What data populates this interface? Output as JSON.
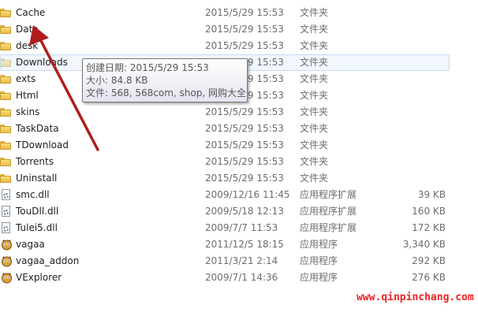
{
  "files": [
    {
      "name": "Cache",
      "date": "2015/5/29 15:53",
      "type": "文件夹",
      "size": "",
      "icon": "folder-icon"
    },
    {
      "name": "Data",
      "date": "2015/5/29 15:53",
      "type": "文件夹",
      "size": "",
      "icon": "folder-icon"
    },
    {
      "name": "desk",
      "date": "2015/5/29 15:53",
      "type": "文件夹",
      "size": "",
      "icon": "folder-icon"
    },
    {
      "name": "Downloads",
      "date": "2015/5/29 15:53",
      "type": "文件夹",
      "size": "",
      "icon": "folder-icon"
    },
    {
      "name": "exts",
      "date": "2015/5/29 15:53",
      "type": "文件夹",
      "size": "",
      "icon": "folder-icon"
    },
    {
      "name": "Html",
      "date": "2015/5/29 15:53",
      "type": "文件夹",
      "size": "",
      "icon": "folder-icon"
    },
    {
      "name": "skins",
      "date": "2015/5/29 15:53",
      "type": "文件夹",
      "size": "",
      "icon": "folder-icon"
    },
    {
      "name": "TaskData",
      "date": "2015/5/29 15:53",
      "type": "文件夹",
      "size": "",
      "icon": "folder-icon"
    },
    {
      "name": "TDownload",
      "date": "2015/5/29 15:53",
      "type": "文件夹",
      "size": "",
      "icon": "folder-icon"
    },
    {
      "name": "Torrents",
      "date": "2015/5/29 15:53",
      "type": "文件夹",
      "size": "",
      "icon": "folder-icon"
    },
    {
      "name": "Uninstall",
      "date": "2015/5/29 15:53",
      "type": "文件夹",
      "size": "",
      "icon": "folder-icon"
    },
    {
      "name": "smc.dll",
      "date": "2009/12/16 11:45",
      "type": "应用程序扩展",
      "size": "39 KB",
      "icon": "dll-file-icon"
    },
    {
      "name": "TouDll.dll",
      "date": "2009/5/18 12:13",
      "type": "应用程序扩展",
      "size": "160 KB",
      "icon": "dll-file-icon"
    },
    {
      "name": "Tulei5.dll",
      "date": "2009/7/7 11:53",
      "type": "应用程序扩展",
      "size": "172 KB",
      "icon": "dll-file-icon"
    },
    {
      "name": "vagaa",
      "date": "2011/12/5 18:15",
      "type": "应用程序",
      "size": "3,340 KB",
      "icon": "vagaa-app-icon"
    },
    {
      "name": "vagaa_addon",
      "date": "2011/3/21 2:14",
      "type": "应用程序",
      "size": "292 KB",
      "icon": "vagaa-app-icon"
    },
    {
      "name": "VExplorer",
      "date": "2009/7/1 14:36",
      "type": "应用程序",
      "size": "276 KB",
      "icon": "vagaa-app-icon"
    }
  ],
  "tooltip": {
    "created": "创建日期: 2015/5/29 15:53",
    "size": "大小: 84.8 KB",
    "files": "文件: 568, 568com, shop, 网购大全"
  },
  "watermark": "www.qinpinchang.com",
  "colors": {
    "arrow": "#b01d1d",
    "watermark": "#ee2222",
    "hover": "#c5dcf1"
  }
}
